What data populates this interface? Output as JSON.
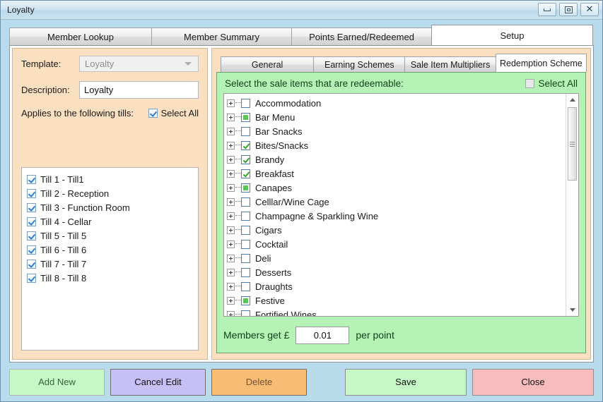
{
  "window": {
    "title": "Loyalty",
    "controls": [
      {
        "name": "minimize-button",
        "icon": "minimize-icon"
      },
      {
        "name": "maximize-button",
        "icon": "maximize-icon"
      },
      {
        "name": "close-button",
        "icon": "close-icon",
        "glyph": "✕"
      }
    ]
  },
  "main_tabs": [
    {
      "label": "Member Lookup",
      "active": false
    },
    {
      "label": "Member Summary",
      "active": false
    },
    {
      "label": "Points Earned/Redeemed",
      "active": false
    },
    {
      "label": "Setup",
      "active": true
    }
  ],
  "setup": {
    "template": {
      "label": "Template:",
      "value": "Loyalty",
      "disabled": true
    },
    "description": {
      "label": "Description:",
      "value": "Loyalty",
      "placeholder": ""
    },
    "tills": {
      "heading": "Applies to the following tills:",
      "select_all_label": "Select All",
      "select_all_checked": true,
      "items": [
        {
          "label": "Till 1 - Till1",
          "checked": true
        },
        {
          "label": "Till 2 - Reception",
          "checked": true
        },
        {
          "label": "Till 3 - Function Room",
          "checked": true
        },
        {
          "label": "Till 4 - Cellar",
          "checked": true
        },
        {
          "label": "Till 5 - Till 5",
          "checked": true
        },
        {
          "label": "Till 6 - Till 6",
          "checked": true
        },
        {
          "label": "Till 7 - Till 7",
          "checked": true
        },
        {
          "label": "Till 8 - Till 8",
          "checked": true
        }
      ]
    }
  },
  "inner_tabs": [
    {
      "label": "General",
      "active": false
    },
    {
      "label": "Earning Schemes",
      "active": false
    },
    {
      "label": "Sale Item Multipliers",
      "active": false
    },
    {
      "label": "Redemption Scheme",
      "active": true
    }
  ],
  "redemption": {
    "heading": "Select the sale items that are redeemable:",
    "select_all_label": "Select All",
    "select_all_state": "unchecked",
    "sale_items": [
      {
        "label": "Accommodation",
        "state": "unchecked"
      },
      {
        "label": "Bar Menu",
        "state": "partial"
      },
      {
        "label": "Bar Snacks",
        "state": "unchecked"
      },
      {
        "label": "Bites/Snacks",
        "state": "checked"
      },
      {
        "label": "Brandy",
        "state": "checked"
      },
      {
        "label": "Breakfast",
        "state": "checked"
      },
      {
        "label": "Canapes",
        "state": "partial"
      },
      {
        "label": "Celllar/Wine Cage",
        "state": "unchecked"
      },
      {
        "label": "Champagne & Sparkling Wine",
        "state": "unchecked"
      },
      {
        "label": "Cigars",
        "state": "unchecked"
      },
      {
        "label": "Cocktail",
        "state": "unchecked"
      },
      {
        "label": "Deli",
        "state": "unchecked"
      },
      {
        "label": "Desserts",
        "state": "unchecked"
      },
      {
        "label": "Draughts",
        "state": "unchecked"
      },
      {
        "label": "Festive",
        "state": "partial"
      },
      {
        "label": "Fortified Wines",
        "state": "unchecked"
      }
    ],
    "rate": {
      "prefix": "Members get £",
      "value": "0.01",
      "suffix": "per point"
    }
  },
  "actions": {
    "add_new": "Add New",
    "cancel_edit": "Cancel Edit",
    "delete": "Delete",
    "save": "Save",
    "close": "Close"
  },
  "colors": {
    "window_bg": "#b9dced",
    "left_panel_bg": "#fbdfc1",
    "green_panel_bg": "#b5f2b5",
    "add_new_bg": "#c6f7c6",
    "cancel_bg": "#c7c0f7",
    "delete_bg": "#f9bc74",
    "save_bg": "#c6f7c6",
    "close_bg": "#f9bcbc"
  }
}
